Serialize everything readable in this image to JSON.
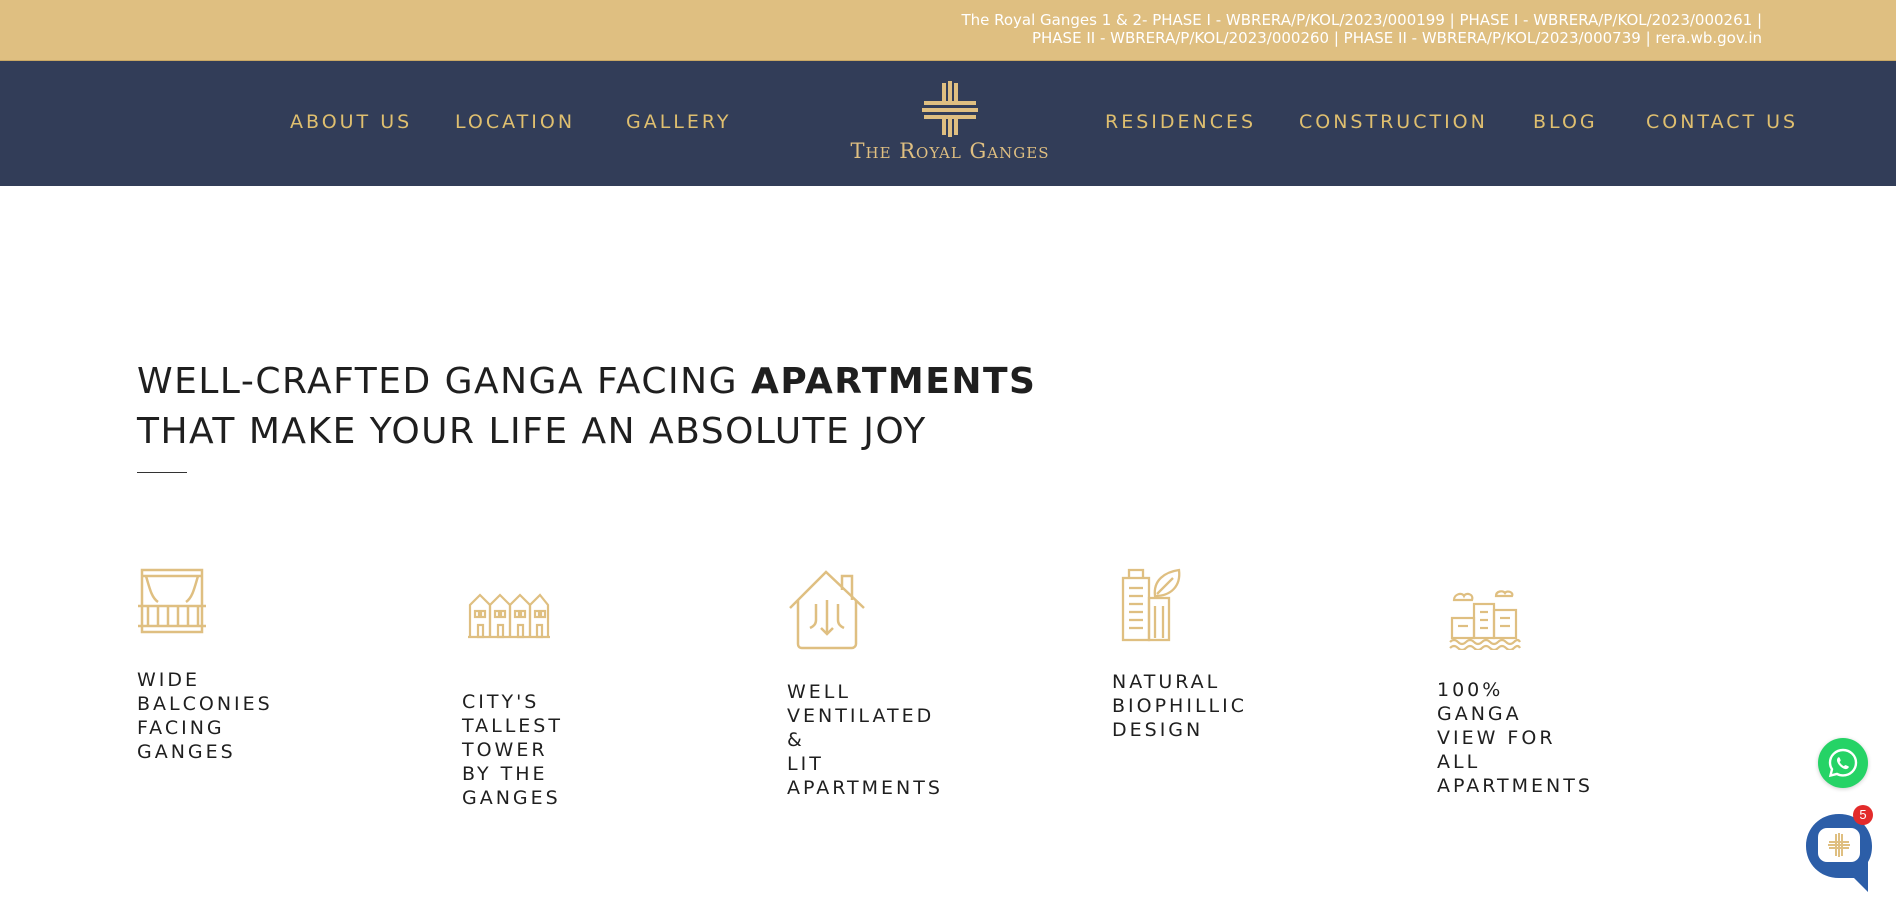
{
  "rera": {
    "line1": "The Royal Ganges 1 & 2- PHASE I - WBRERA/P/KOL/2023/000199 | PHASE I - WBRERA/P/KOL/2023/000261 |",
    "line2": "PHASE II - WBRERA/P/KOL/2023/000260 | PHASE II - WBRERA/P/KOL/2023/000739 | rera.wb.gov.in"
  },
  "nav": {
    "left": [
      "ABOUT US",
      "LOCATION",
      "GALLERY"
    ],
    "right": [
      "RESIDENCES",
      "CONSTRUCTION",
      "BLOG",
      "CONTACT US"
    ],
    "logo_text": "The Royal Ganges"
  },
  "headline": {
    "line1_regular": "WELL-CRAFTED GANGA FACING ",
    "line1_bold": "APARTMENTS",
    "line2": "THAT MAKE YOUR LIFE AN ABSOLUTE JOY"
  },
  "features": [
    {
      "icon": "balcony-icon",
      "label": "WIDE\nBALCONIES\nFACING GANGES"
    },
    {
      "icon": "buildings-icon",
      "label": "CITY'S TALLEST\nTOWER BY THE\nGANGES"
    },
    {
      "icon": "ventilated-house-icon",
      "label": "WELL\nVENTILATED &\nLIT\nAPARTMENTS"
    },
    {
      "icon": "biophilic-building-icon",
      "label": "NATURAL\nBIOPHILLIC\nDESIGN"
    },
    {
      "icon": "river-view-icon",
      "label": "100% GANGA\nVIEW FOR ALL\nAPARTMENTS"
    }
  ],
  "chat": {
    "badge_count": "5"
  },
  "colors": {
    "gold": "#dfbf81",
    "navy": "#323d58",
    "text": "#1f1f1f",
    "whatsapp": "#25d366"
  }
}
